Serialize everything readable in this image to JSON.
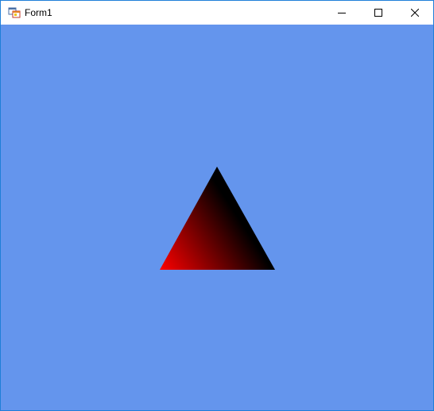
{
  "window": {
    "title": "Form1",
    "border_color": "#1f7fd8"
  },
  "titlebar": {
    "icon": "winforms-app-icon",
    "buttons": {
      "minimize": "minimize-icon",
      "maximize": "maximize-icon",
      "close": "close-icon"
    }
  },
  "client": {
    "background_color": "#6495ed",
    "triangle": {
      "vertex_colors": {
        "bottom_left": "#ff0000",
        "top": "#000000",
        "bottom_right": "#000000"
      }
    }
  }
}
